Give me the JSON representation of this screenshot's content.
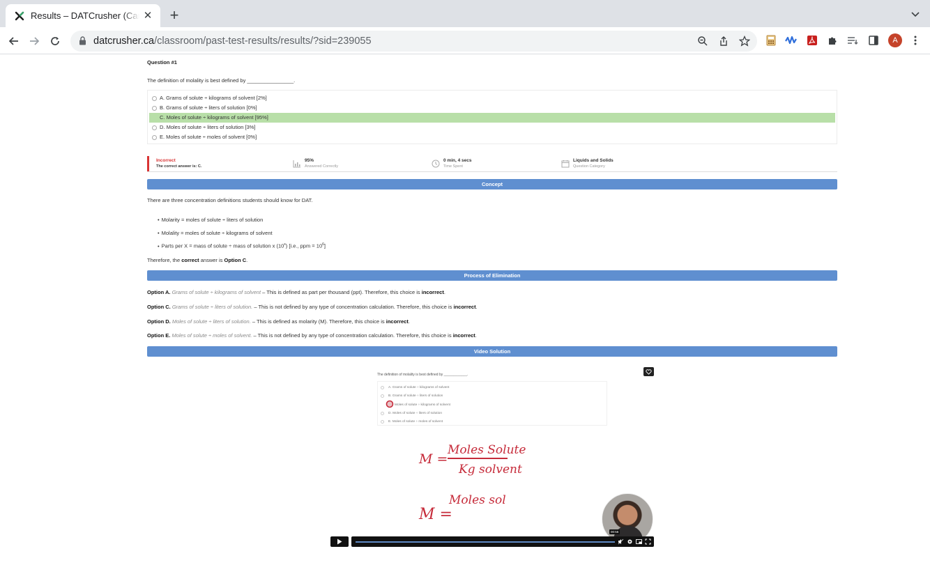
{
  "browser": {
    "tab_title": "Results – DATCrusher (Canadian)",
    "url_domain": "datcrusher.ca",
    "url_path": "/classroom/past-test-results/results/?sid=239055",
    "avatar_letter": "A"
  },
  "question": {
    "number_label": "Question #1",
    "text": "The definition of molality is best defined by ________________.",
    "options": [
      {
        "label": "A. Grams of solute ÷ kilograms of solvent [2%]",
        "correct": false
      },
      {
        "label": "B. Grams of solute ÷ liters of solution [0%]",
        "correct": false
      },
      {
        "label": "C. Moles of solute ÷ kilograms of solvent [95%]",
        "correct": true
      },
      {
        "label": "D. Moles of solute ÷ liters of solution [3%]",
        "correct": false
      },
      {
        "label": "E. Moles of solute ÷ moles of solvent [0%]",
        "correct": false
      }
    ]
  },
  "stats": {
    "status": "Incorrect",
    "correct_answer": "The correct answer is: C.",
    "percent": "95%",
    "percent_label": "Answered Correctly",
    "time": "0 min, 4 secs",
    "time_label": "Time Spent",
    "category": "Liquids and Solids",
    "category_label": "Question Category"
  },
  "concept": {
    "title": "Concept",
    "intro": "There are three concentration definitions students should know for DAT.",
    "bullets": [
      "Molarity = moles of solute ÷ liters of solution",
      "Molality = moles of solute ÷ kilograms of solvent",
      "Parts per X = mass of solute ÷ mass of solution x (10",
      "x",
      ") [i.e., ppm = 10",
      "6",
      "]"
    ],
    "conclusion_pre": "Therefore, the ",
    "conclusion_bold1": "correct",
    "conclusion_mid": " answer is ",
    "conclusion_bold2": "Option C",
    "conclusion_end": "."
  },
  "elimination": {
    "title": "Process of Elimination",
    "items": [
      {
        "option": "Option A.",
        "italic": "Grams of solute ÷ kilograms of solvent",
        "text": " – This is defined as part per thousand (ppt). Therefore, this choice is ",
        "verdict": "incorrect",
        "end": "."
      },
      {
        "option": "Option C.",
        "italic": "Grams of solute ÷ liters of solution.",
        "text": " – This is not defined by any type of concentration calculation. Therefore, this choice is ",
        "verdict": "incorrect",
        "end": "."
      },
      {
        "option": "Option D.",
        "italic": "Moles of solute ÷ liters of solution.",
        "text": " – This is defined as molarity (M). Therefore, this choice is ",
        "verdict": "incorrect",
        "end": "."
      },
      {
        "option": "Option E.",
        "italic": "Moles of solute ÷ moles of solvent.",
        "text": " – This is not defined by any type of concentration calculation. Therefore, this choice is ",
        "verdict": "incorrect",
        "end": "."
      }
    ]
  },
  "video": {
    "title": "Video Solution",
    "frame_question": "The definition of molality is best defined by ____________.",
    "frame_options": [
      "A. Grams of solute ÷ kilograms of solvent",
      "B. Grams of solute ÷ liters of solution",
      "Moles of solute ÷ kilograms of solvent",
      "D. Moles of solute ÷ liters of solution",
      "E. Moles of solute ÷ moles of solvent"
    ],
    "hand_m1": "M =",
    "hand_numerator": "Moles Solute",
    "hand_denominator": "Kg solvent",
    "hand_m2": "M =",
    "hand_partial": "Moles sol",
    "time_badge": "00:56",
    "progress": 0.86
  },
  "colors": {
    "correct_bg": "#b8dfa8",
    "section_bar": "#5f8fd0",
    "incorrect": "#d93434",
    "handwriting": "#c62b3a"
  }
}
